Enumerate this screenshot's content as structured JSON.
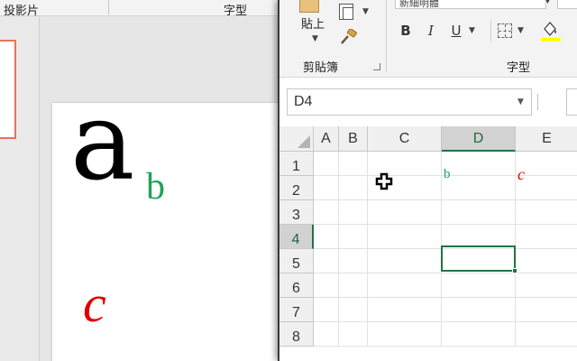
{
  "ppt": {
    "ribbon": {
      "slides_group": "投影片",
      "font_group": "字型"
    },
    "slide": {
      "letter_a": "a",
      "letter_b": "b",
      "letter_c": "c"
    }
  },
  "excel": {
    "ribbon": {
      "paste_label": "貼上",
      "clipboard_group": "剪貼簿",
      "font_group": "字型",
      "font_name": "新細明體",
      "bold": "B",
      "italic": "I",
      "underline": "U"
    },
    "name_box": "D4",
    "columns": [
      "A",
      "B",
      "C",
      "D",
      "E"
    ],
    "rows": [
      "1",
      "2",
      "3",
      "4",
      "5",
      "6",
      "7",
      "8"
    ],
    "active_column": "D",
    "active_row": "4",
    "cells": {
      "D1": "b",
      "E1": "c"
    },
    "colors": {
      "accent": "#217346",
      "green_text": "#1fa358",
      "red_text": "#e00000"
    }
  }
}
